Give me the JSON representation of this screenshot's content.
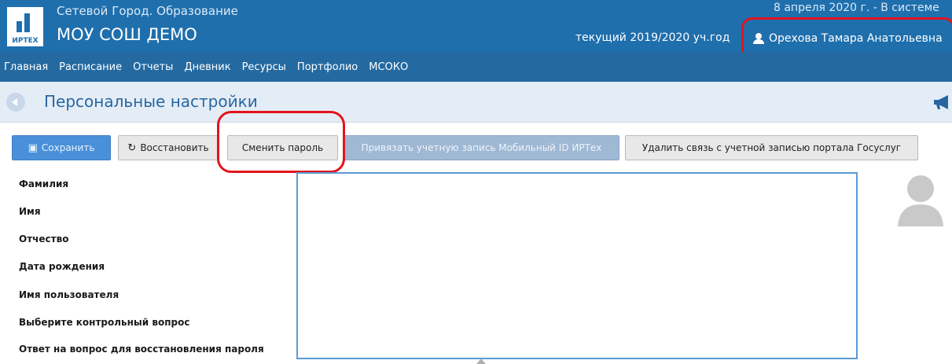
{
  "header": {
    "logo_brand": "ИРТЕХ",
    "app_name": "Сетевой Город. Образование",
    "school_name": "МОУ СОШ ДЕМО",
    "date_line": "8 апреля 2020 г. - В системе",
    "academic_year": "текущий 2019/2020 уч.год",
    "user_name": "Орехова Тамара Анатольевна"
  },
  "nav": {
    "items": [
      {
        "label": "Главная"
      },
      {
        "label": "Расписание"
      },
      {
        "label": "Отчеты"
      },
      {
        "label": "Дневник"
      },
      {
        "label": "Ресурсы"
      },
      {
        "label": "Портфолио"
      },
      {
        "label": "МСОКО"
      }
    ]
  },
  "page": {
    "title": "Персональные настройки"
  },
  "toolbar": {
    "save_label": "Сохранить",
    "restore_label": "Восстановить",
    "change_password_label": "Сменить пароль",
    "link_mobile_id_label": "Привязать учетную запись Мобильный ID ИРТех",
    "remove_gosuslugi_label": "Удалить связь с учетной записью портала Госуслуг"
  },
  "form": {
    "labels": [
      "Фамилия",
      "Имя",
      "Отчество",
      "Дата рождения",
      "Имя пользователя",
      "Выберите контрольный вопрос",
      "Ответ на вопрос для восстановления пароля"
    ]
  },
  "colors": {
    "header_blue": "#1f6fad",
    "highlight_red": "#e3141c",
    "primary_button": "#4a90d9"
  },
  "icons": {
    "user": "person-icon",
    "back": "back-arrow-icon",
    "announcement": "megaphone-icon",
    "save": "floppy-disk-icon",
    "restore": "refresh-icon",
    "avatar": "avatar-placeholder"
  }
}
